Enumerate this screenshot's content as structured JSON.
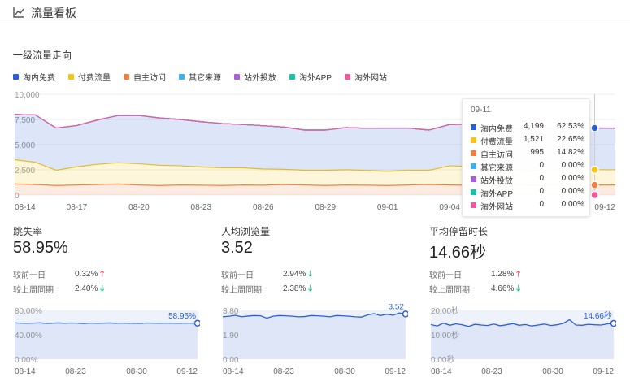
{
  "header": {
    "title": "流量看板",
    "icon": "line-chart-icon"
  },
  "section": {
    "title": "一级流量走向"
  },
  "legend": [
    {
      "name": "淘内免费",
      "color": "#2b5fd9"
    },
    {
      "name": "付费流量",
      "color": "#f5c518"
    },
    {
      "name": "自主访问",
      "color": "#f07e3c"
    },
    {
      "name": "其它来源",
      "color": "#3fb1f2"
    },
    {
      "name": "站外投放",
      "color": "#a95ed9"
    },
    {
      "name": "淘外APP",
      "color": "#17c3a5"
    },
    {
      "name": "淘外网站",
      "color": "#f25aa0"
    }
  ],
  "tooltip": {
    "date": "09-11",
    "rows": [
      {
        "name": "淘内免费",
        "value": "4,199",
        "pct": "62.53%",
        "color": "#2b5fd9"
      },
      {
        "name": "付费流量",
        "value": "1,521",
        "pct": "22.65%",
        "color": "#f5c518"
      },
      {
        "name": "自主访问",
        "value": "995",
        "pct": "14.82%",
        "color": "#f07e3c"
      },
      {
        "name": "其它来源",
        "value": "0",
        "pct": "0.00%",
        "color": "#3fb1f2"
      },
      {
        "name": "站外投放",
        "value": "0",
        "pct": "0.00%",
        "color": "#a95ed9"
      },
      {
        "name": "淘外APP",
        "value": "0",
        "pct": "0.00%",
        "color": "#17c3a5"
      },
      {
        "name": "淘外网站",
        "value": "0",
        "pct": "0.00%",
        "color": "#f25aa0"
      }
    ]
  },
  "chart_data": [
    {
      "type": "area",
      "stacked": true,
      "x_labels": [
        "08-14",
        "08-17",
        "08-20",
        "08-23",
        "08-26",
        "08-29",
        "09-01",
        "09-04",
        "09-12"
      ],
      "y_ticks": [
        "10,000",
        "7,500",
        "5,000",
        "2,500",
        "0"
      ],
      "ylim": [
        0,
        10000
      ],
      "series": [
        {
          "name": "自主访问",
          "color": "#f07e3c",
          "values": [
            1100,
            1050,
            950,
            1000,
            1050,
            1100,
            1000,
            950,
            1000,
            980,
            950,
            1000,
            980,
            1050,
            1000,
            950,
            1000,
            980,
            950,
            1000,
            1050,
            1000,
            980,
            950,
            1000,
            990,
            995,
            1000,
            995,
            995
          ]
        },
        {
          "name": "付费流量",
          "color": "#f5c518",
          "values": [
            2400,
            2200,
            1500,
            1800,
            2000,
            2100,
            2100,
            2000,
            1900,
            1800,
            1750,
            1700,
            1600,
            1500,
            1450,
            1500,
            1500,
            1450,
            1400,
            1450,
            1400,
            1900,
            1850,
            1600,
            1450,
            1400,
            1500,
            1521,
            1510,
            1500
          ]
        },
        {
          "name": "淘内免费",
          "color": "#2b5fd9",
          "values": [
            4500,
            4700,
            4200,
            4100,
            4400,
            4700,
            4800,
            4700,
            4600,
            4500,
            4400,
            4300,
            4300,
            4200,
            4000,
            4000,
            4200,
            4200,
            4300,
            4200,
            4000,
            4100,
            4200,
            4300,
            4200,
            4100,
            4150,
            4199,
            4150,
            4150
          ]
        },
        {
          "name": "其它来源",
          "color": "#3fb1f2",
          "values": [
            0,
            0,
            0,
            0,
            0,
            0,
            0,
            0,
            0,
            0,
            0,
            0,
            0,
            0,
            0,
            0,
            0,
            0,
            0,
            0,
            0,
            0,
            0,
            0,
            0,
            0,
            0,
            0,
            0,
            0
          ]
        },
        {
          "name": "站外投放",
          "color": "#a95ed9",
          "values": [
            0,
            0,
            0,
            0,
            0,
            0,
            0,
            0,
            0,
            0,
            0,
            0,
            0,
            0,
            0,
            0,
            0,
            0,
            0,
            0,
            0,
            0,
            0,
            0,
            0,
            0,
            0,
            0,
            0,
            0
          ]
        },
        {
          "name": "淘外APP",
          "color": "#17c3a5",
          "values": [
            0,
            0,
            0,
            0,
            0,
            0,
            0,
            0,
            0,
            0,
            0,
            0,
            0,
            0,
            0,
            0,
            0,
            0,
            0,
            0,
            0,
            0,
            0,
            0,
            0,
            0,
            0,
            0,
            0,
            0
          ]
        },
        {
          "name": "淘外网站",
          "color": "#f25aa0",
          "values": [
            0,
            0,
            0,
            0,
            0,
            0,
            0,
            0,
            0,
            0,
            0,
            0,
            0,
            0,
            0,
            0,
            0,
            0,
            0,
            0,
            0,
            0,
            0,
            0,
            0,
            0,
            0,
            0,
            0,
            0
          ]
        }
      ],
      "hover_index": 28
    },
    {
      "type": "area",
      "x_labels": [
        "08-14",
        "08-23",
        "08-30",
        "09-12"
      ],
      "y_ticks": [
        "80.00%",
        "40.00%",
        "0.00%"
      ],
      "ylim": [
        0,
        80
      ],
      "values": [
        59.5,
        59,
        58.8,
        59.2,
        59.6,
        58.7,
        59.1,
        59.4,
        58.9,
        59.3,
        59,
        58.6,
        59.2,
        58.8,
        59.1,
        59.4,
        58.9,
        59.2,
        58.8,
        59.1,
        58.7,
        59.3,
        59,
        58.9,
        59.2,
        59,
        58.8,
        59.1,
        59,
        58.95
      ],
      "end_label": "58.95%"
    },
    {
      "type": "area",
      "x_labels": [
        "08-14",
        "08-23",
        "08-30",
        "09-12"
      ],
      "y_ticks": [
        "3.80",
        "1.90",
        "0.00"
      ],
      "ylim": [
        0,
        3.8
      ],
      "values": [
        3.3,
        3.35,
        3.42,
        3.3,
        3.36,
        3.4,
        3.38,
        3.2,
        3.35,
        3.4,
        3.38,
        3.35,
        3.3,
        3.32,
        3.4,
        3.38,
        3.35,
        3.3,
        3.4,
        3.38,
        3.35,
        3.3,
        3.28,
        3.45,
        3.55,
        3.4,
        3.5,
        3.42,
        3.6,
        3.52
      ],
      "end_label": "3.52"
    },
    {
      "type": "area",
      "x_labels": [
        "08-14",
        "08-23",
        "08-30",
        "09-12"
      ],
      "y_ticks": [
        "20.00秒",
        "10.00秒",
        "0.00秒"
      ],
      "ylim": [
        0,
        20
      ],
      "values": [
        14.2,
        13.6,
        14.8,
        13.9,
        14.5,
        14.1,
        13.4,
        14.3,
        14.0,
        13.8,
        14.4,
        13.7,
        14.1,
        14.6,
        13.9,
        14.2,
        13.6,
        14.0,
        14.4,
        13.8,
        14.1,
        14.7,
        16.2,
        14.0,
        13.9,
        14.3,
        14.1,
        14.0,
        14.5,
        14.66
      ],
      "end_label": "14.66秒"
    }
  ],
  "metrics": [
    {
      "label": "跳失率",
      "value": "58.95%",
      "cmp1_label": "较前一日",
      "cmp1_value": "0.32%",
      "cmp1_dir": "up",
      "cmp2_label": "较上周同期",
      "cmp2_value": "2.40%",
      "cmp2_dir": "down"
    },
    {
      "label": "人均浏览量",
      "value": "3.52",
      "cmp1_label": "较前一日",
      "cmp1_value": "2.94%",
      "cmp1_dir": "down",
      "cmp2_label": "较上周同期",
      "cmp2_value": "2.38%",
      "cmp2_dir": "down"
    },
    {
      "label": "平均停留时长",
      "value": "14.66秒",
      "cmp1_label": "较前一日",
      "cmp1_value": "1.28%",
      "cmp1_dir": "up",
      "cmp2_label": "较上周同期",
      "cmp2_value": "4.66%",
      "cmp2_dir": "down"
    }
  ],
  "arrows": {
    "up": "🡑",
    "down": "🡓"
  }
}
